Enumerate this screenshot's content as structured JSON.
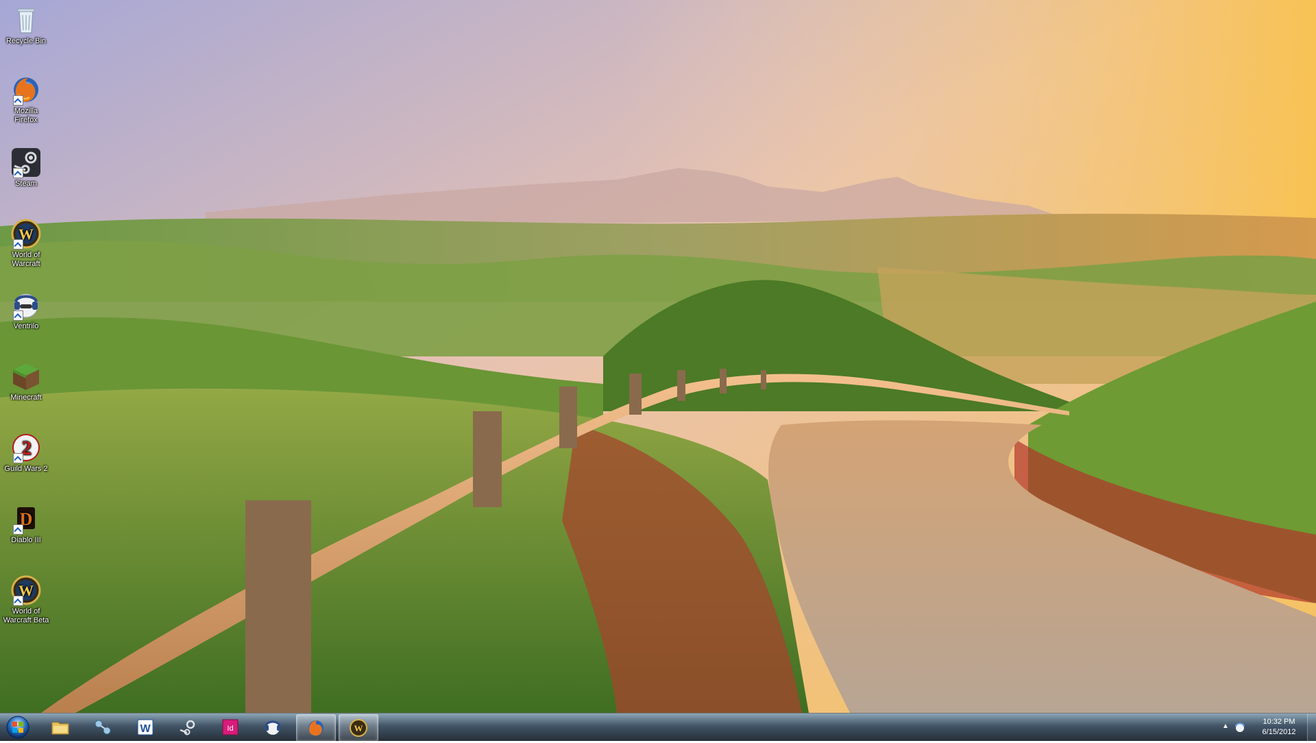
{
  "desktop": {
    "icons": [
      {
        "name": "recycle-bin",
        "label": "Recycle Bin",
        "icon": "recycle-bin-icon"
      },
      {
        "name": "mozilla-firefox",
        "label": "Mozilla Firefox",
        "icon": "firefox-icon"
      },
      {
        "name": "steam",
        "label": "Steam",
        "icon": "steam-icon"
      },
      {
        "name": "world-of-warcraft",
        "label": "World of Warcraft",
        "icon": "wow-icon"
      },
      {
        "name": "ventrilo",
        "label": "Ventrilo",
        "icon": "ventrilo-icon"
      },
      {
        "name": "minecraft",
        "label": "Minecraft",
        "icon": "minecraft-icon"
      },
      {
        "name": "guild-wars-2",
        "label": "Guild Wars 2",
        "icon": "guild-wars-2-icon"
      },
      {
        "name": "diablo-iii",
        "label": "Diablo III",
        "icon": "diablo-icon"
      },
      {
        "name": "world-of-warcraft-beta",
        "label": "World of Warcraft Beta",
        "icon": "wow-icon"
      }
    ]
  },
  "taskbar": {
    "start_icon": "windows-start-orb-icon",
    "pinned": [
      {
        "name": "explorer",
        "icon": "folder-icon",
        "active": false
      },
      {
        "name": "network",
        "icon": "network-icon",
        "active": false
      },
      {
        "name": "word",
        "icon": "word-icon",
        "active": false
      },
      {
        "name": "steam",
        "icon": "steam-icon",
        "active": false
      },
      {
        "name": "indesign",
        "icon": "indesign-icon",
        "active": false
      },
      {
        "name": "ventrilo",
        "icon": "ventrilo-icon",
        "active": false
      },
      {
        "name": "firefox",
        "icon": "firefox-icon",
        "active": true
      },
      {
        "name": "world-of-warcraft",
        "icon": "wow-icon",
        "active": true
      }
    ],
    "tray": {
      "time": "10:32 PM",
      "date": "6/15/2012"
    }
  }
}
